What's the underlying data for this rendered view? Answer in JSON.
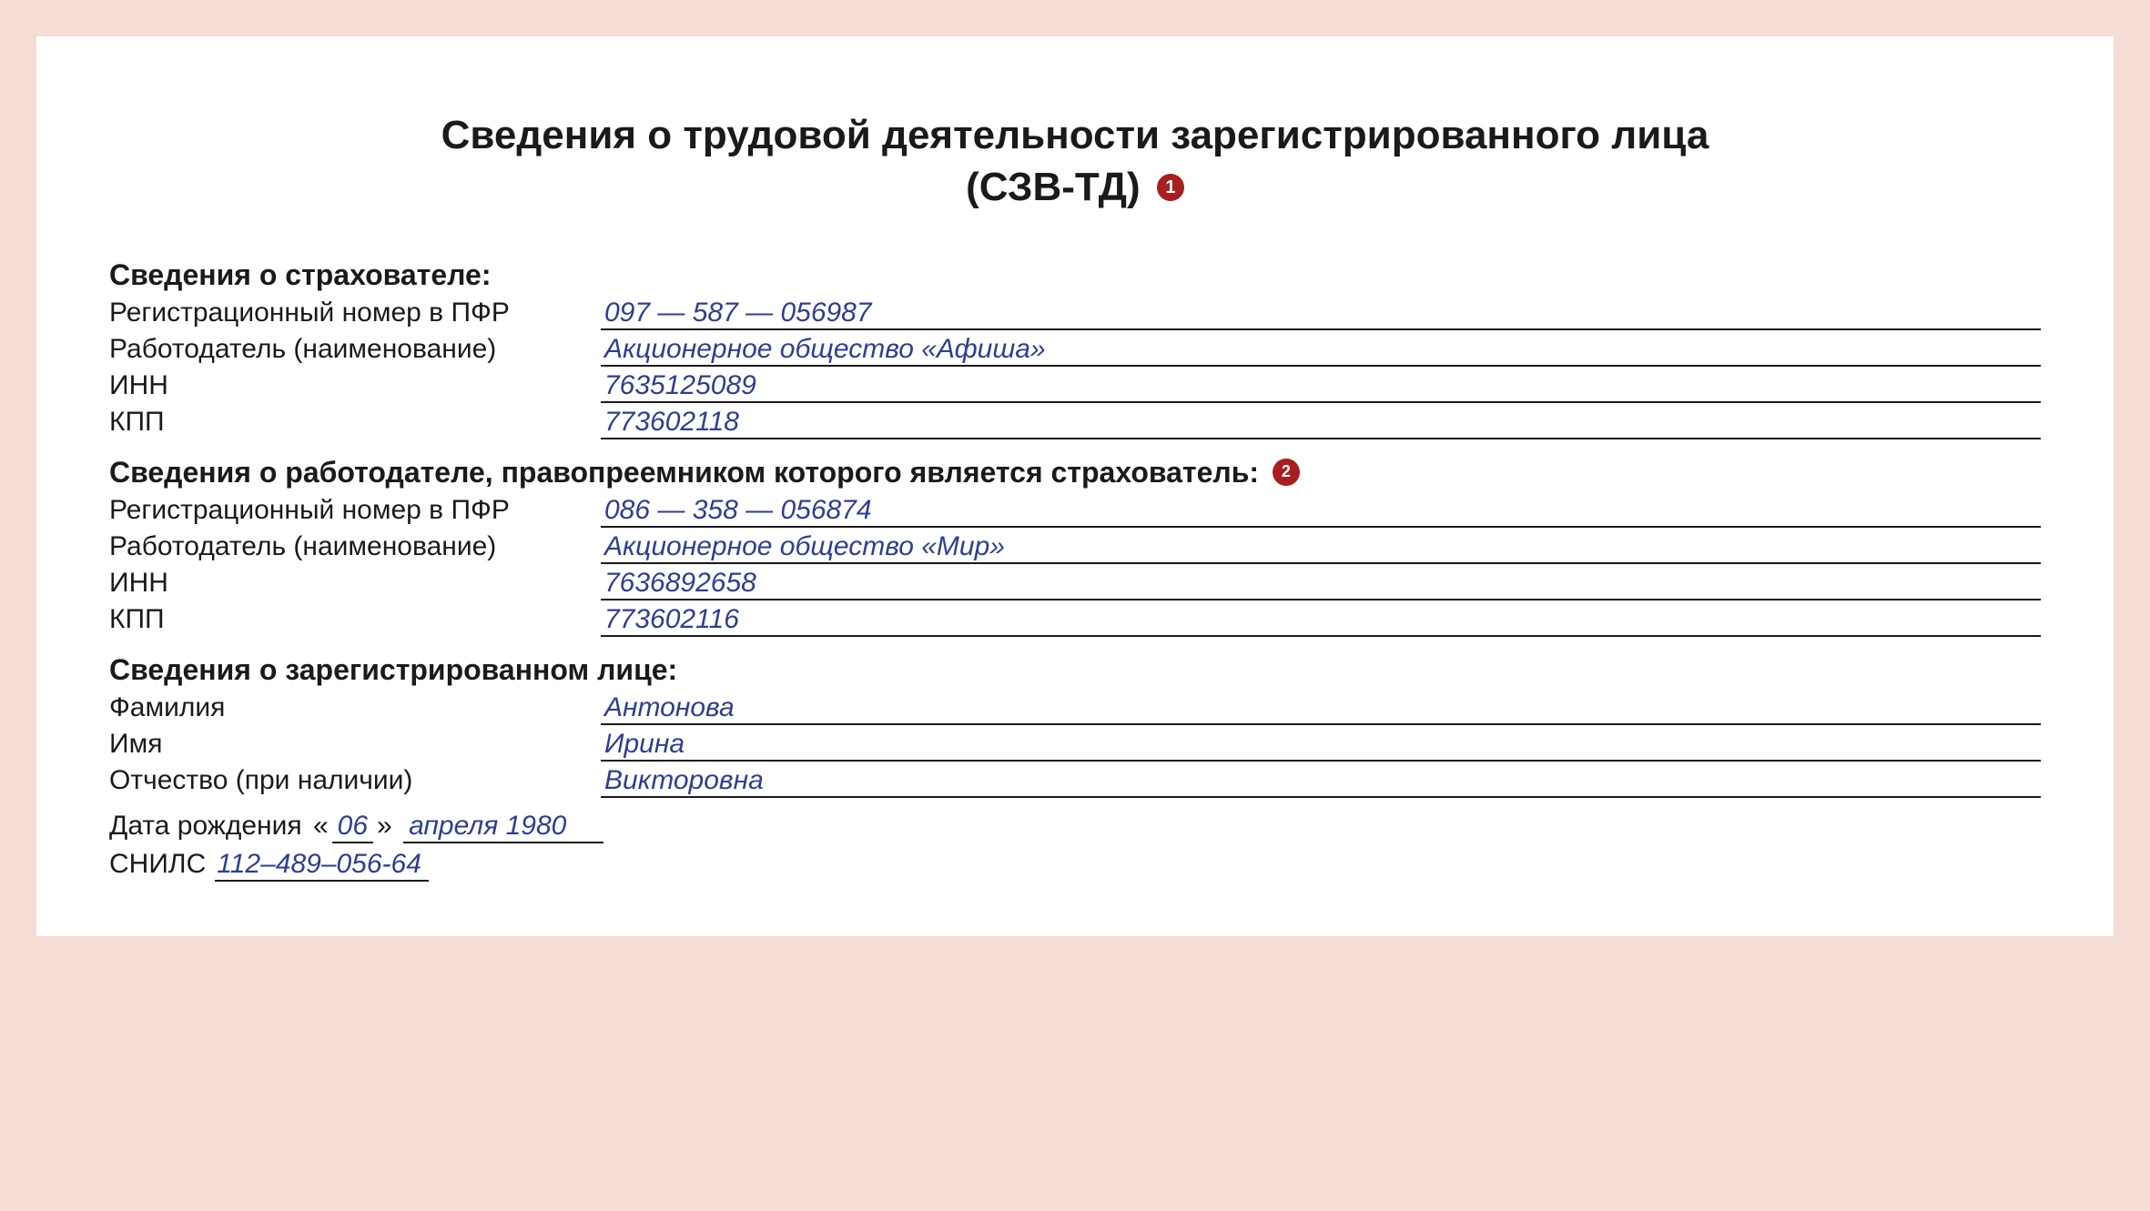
{
  "title_line1": "Сведения о трудовой деятельности зарегистрированного лица",
  "title_line2": "(СЗВ-ТД)",
  "badge1": "1",
  "badge2": "2",
  "section1": {
    "heading": "Сведения о страхователе:",
    "reg_label": "Регистрационный номер в ПФР",
    "reg_value": "097 —  587 — 056987",
    "employer_label": "Работодатель (наименование)",
    "employer_value": "Акционерное общество «Афиша»",
    "inn_label": "ИНН",
    "inn_value": "7635125089",
    "kpp_label": "КПП",
    "kpp_value": "773602118"
  },
  "section2": {
    "heading": "Сведения о работодателе, правопреемником которого является страхователь:",
    "reg_label": "Регистрационный номер в ПФР",
    "reg_value": "086 —  358 — 056874",
    "employer_label": "Работодатель (наименование)",
    "employer_value": "Акционерное общество «Мир»",
    "inn_label": "ИНН",
    "inn_value": "7636892658",
    "kpp_label": "КПП",
    "kpp_value": "773602116"
  },
  "section3": {
    "heading": "Сведения о зарегистрированном лице:",
    "surname_label": "Фамилия",
    "surname_value": "Антонова",
    "name_label": "Имя",
    "name_value": "Ирина",
    "patronymic_label": "Отчество (при наличии)",
    "patronymic_value": "Викторовна",
    "dob_label": "Дата рождения ",
    "dob_day": "06",
    "dob_month_year": "апреля 1980",
    "snils_label": "СНИЛС",
    "snils_value": "112–489–056-64"
  }
}
